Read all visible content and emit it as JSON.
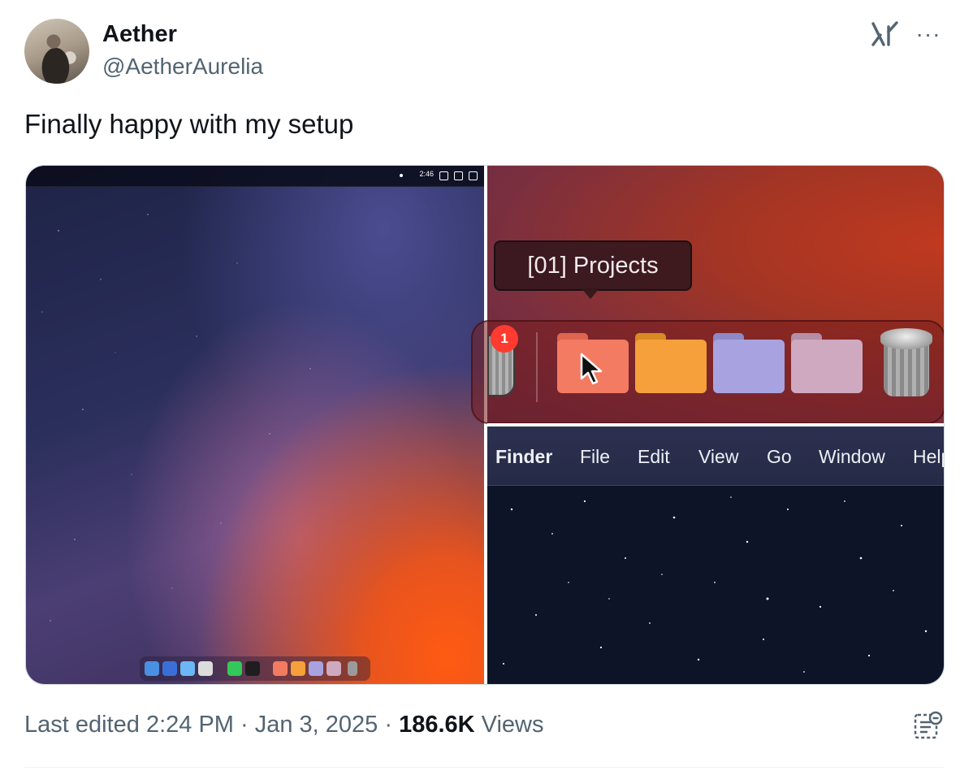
{
  "user": {
    "name": "Aether",
    "handle": "@AetherAurelia"
  },
  "header_icons": [
    "grok-icon",
    "more-icon"
  ],
  "more_label": "···",
  "tweet": {
    "text": "Finally happy with my setup"
  },
  "media": {
    "left_screenshot": {
      "menubar_time": "2:46"
    },
    "dock_detail": {
      "tooltip": "[01] Projects",
      "badge_count": "1",
      "folder_colors": [
        "#f37b62",
        "#f5a03a",
        "#a8a3e0",
        "#cfa9bf"
      ]
    },
    "finder_menu": {
      "items": [
        "Finder",
        "File",
        "Edit",
        "View",
        "Go",
        "Window",
        "Help"
      ]
    }
  },
  "meta": {
    "edited": "Last edited 2:24 PM · Jan 3, 2025 · ",
    "views_count": "186.6K",
    "views_label": " Views"
  },
  "colors": {
    "text_primary": "#0f1419",
    "text_secondary": "#536471",
    "border": "#cfd9de"
  }
}
